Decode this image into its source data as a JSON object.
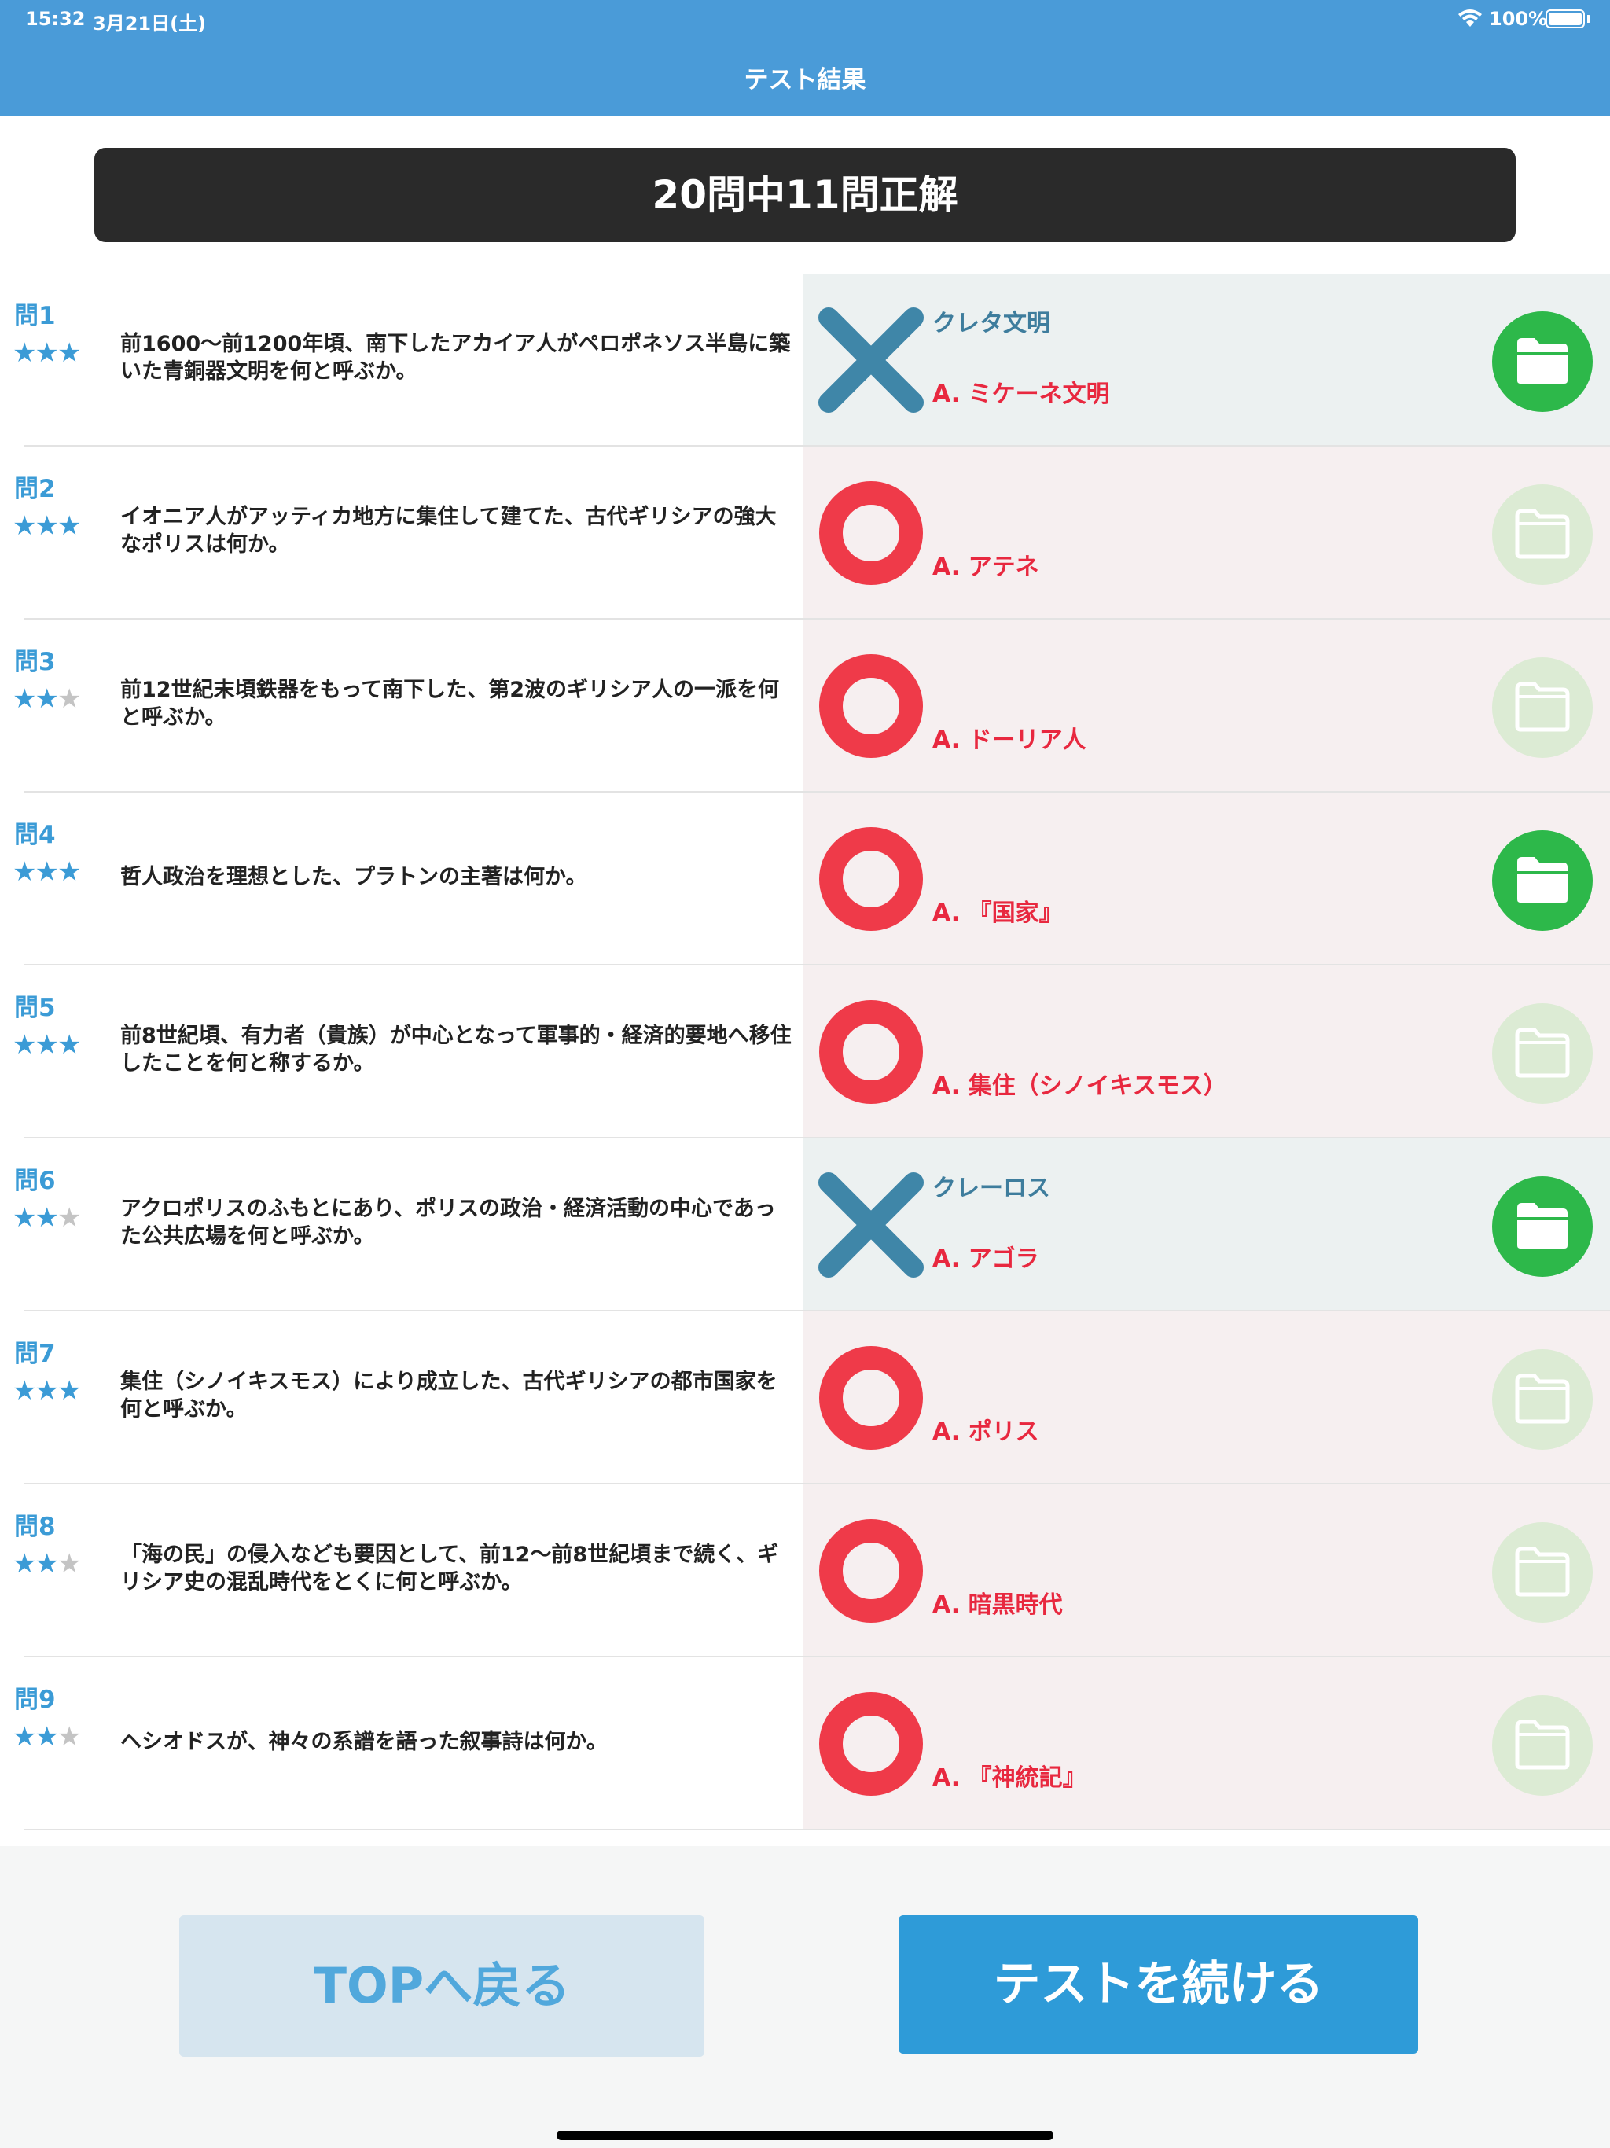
{
  "status": {
    "time": "15:32",
    "date": "3月21日(土)",
    "battery": "100%"
  },
  "nav": {
    "title": "テスト結果"
  },
  "score": {
    "text": "20問中11問正解"
  },
  "colors": {
    "accent": "#4a9bd8",
    "wrong_mark": "#3f86a8",
    "correct_mark": "#ef3a49",
    "folder_on": "#2db84a",
    "folder_off": "#dcebd4"
  },
  "questions": [
    {
      "num": "問1",
      "stars": 3,
      "text": "前1600〜前1200年頃、南下したアカイア人がペロポネソス半島に築いた青銅器文明を何と呼ぶか。",
      "result": "wrong",
      "user_answer": "クレタ文明",
      "answer": "A. ミケーネ文明",
      "folder": "saved",
      "folder_icon": "folder-icon"
    },
    {
      "num": "問2",
      "stars": 3,
      "text": "イオニア人がアッティカ地方に集住して建てた、古代ギリシアの強大なポリスは何か。",
      "result": "correct",
      "user_answer": "",
      "answer": "A. アテネ",
      "folder": "save",
      "folder_icon": "folder-download-icon"
    },
    {
      "num": "問3",
      "stars": 2,
      "text": "前12世紀末頃鉄器をもって南下した、第2波のギリシア人の一派を何と呼ぶか。",
      "result": "correct",
      "user_answer": "",
      "answer": "A. ドーリア人",
      "folder": "save",
      "folder_icon": "folder-download-icon"
    },
    {
      "num": "問4",
      "stars": 3,
      "text": "哲人政治を理想とした、プラトンの主著は何か。",
      "result": "correct",
      "user_answer": "",
      "answer": "A. 『国家』",
      "folder": "saved",
      "folder_icon": "folder-icon"
    },
    {
      "num": "問5",
      "stars": 3,
      "text": "前8世紀頃、有力者（貴族）が中心となって軍事的・経済的要地へ移住したことを何と称するか。",
      "result": "correct",
      "user_answer": "",
      "answer": "A. 集住（シノイキスモス）",
      "folder": "save",
      "folder_icon": "folder-download-icon"
    },
    {
      "num": "問6",
      "stars": 2,
      "text": "アクロポリスのふもとにあり、ポリスの政治・経済活動の中心であった公共広場を何と呼ぶか。",
      "result": "wrong",
      "user_answer": "クレーロス",
      "answer": "A. アゴラ",
      "folder": "saved",
      "folder_icon": "folder-icon"
    },
    {
      "num": "問7",
      "stars": 3,
      "text": "集住（シノイキスモス）により成立した、古代ギリシアの都市国家を何と呼ぶか。",
      "result": "correct",
      "user_answer": "",
      "answer": "A. ポリス",
      "folder": "save",
      "folder_icon": "folder-download-icon"
    },
    {
      "num": "問8",
      "stars": 2,
      "text": "「海の民」の侵入なども要因として、前12〜前8世紀頃まで続く、ギリシア史の混乱時代をとくに何と呼ぶか。",
      "result": "correct",
      "user_answer": "",
      "answer": "A. 暗黒時代",
      "folder": "save",
      "folder_icon": "folder-download-icon"
    },
    {
      "num": "問9",
      "stars": 2,
      "text": "ヘシオドスが、神々の系譜を語った叙事詩は何か。",
      "result": "correct",
      "user_answer": "",
      "answer": "A. 『神統記』",
      "folder": "save",
      "folder_icon": "folder-download-icon"
    }
  ],
  "footer": {
    "top_button": "TOPへ戻る",
    "continue_button": "テストを続ける"
  }
}
